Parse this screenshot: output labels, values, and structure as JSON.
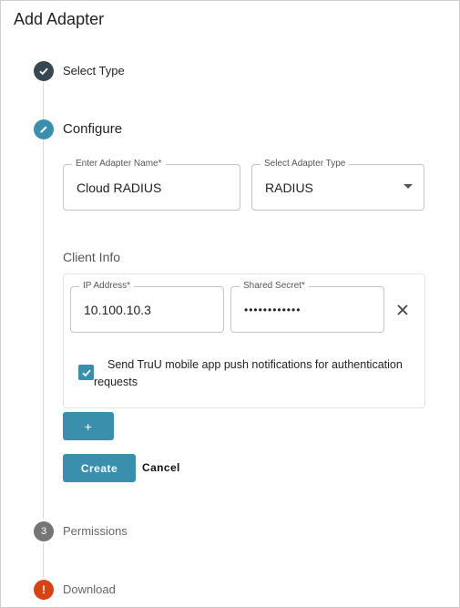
{
  "title": "Add Adapter",
  "steps": [
    {
      "label": "Select Type",
      "state": "done",
      "icon": "check-icon"
    },
    {
      "label": "Configure",
      "state": "active",
      "icon": "pencil-icon"
    },
    {
      "label": "Permissions",
      "state": "pending",
      "number": "3"
    },
    {
      "label": "Download",
      "state": "warning",
      "icon": "warning-icon",
      "mark": "!"
    }
  ],
  "configure": {
    "adapter_name": {
      "label": "Enter Adapter Name*",
      "value": "Cloud RADIUS"
    },
    "adapter_type": {
      "label": "Select Adapter Type",
      "value": "RADIUS"
    },
    "client_info": {
      "heading": "Client Info",
      "ip": {
        "label": "IP Address*",
        "value": "10.100.10.3"
      },
      "secret": {
        "label": "Shared Secret*",
        "value": "••••••••••••"
      },
      "push_checkbox": {
        "checked": true,
        "line1": "Send TruU mobile app push notifications for authentication",
        "line2": "requests"
      }
    },
    "add_button_label": "+",
    "create_label": "Create",
    "cancel_label": "Cancel"
  },
  "colors": {
    "accent": "#3a8fac",
    "done_step": "#37474f",
    "active_step": "#3a8fac",
    "pending_step": "#757575",
    "warning_step": "#d84315"
  }
}
